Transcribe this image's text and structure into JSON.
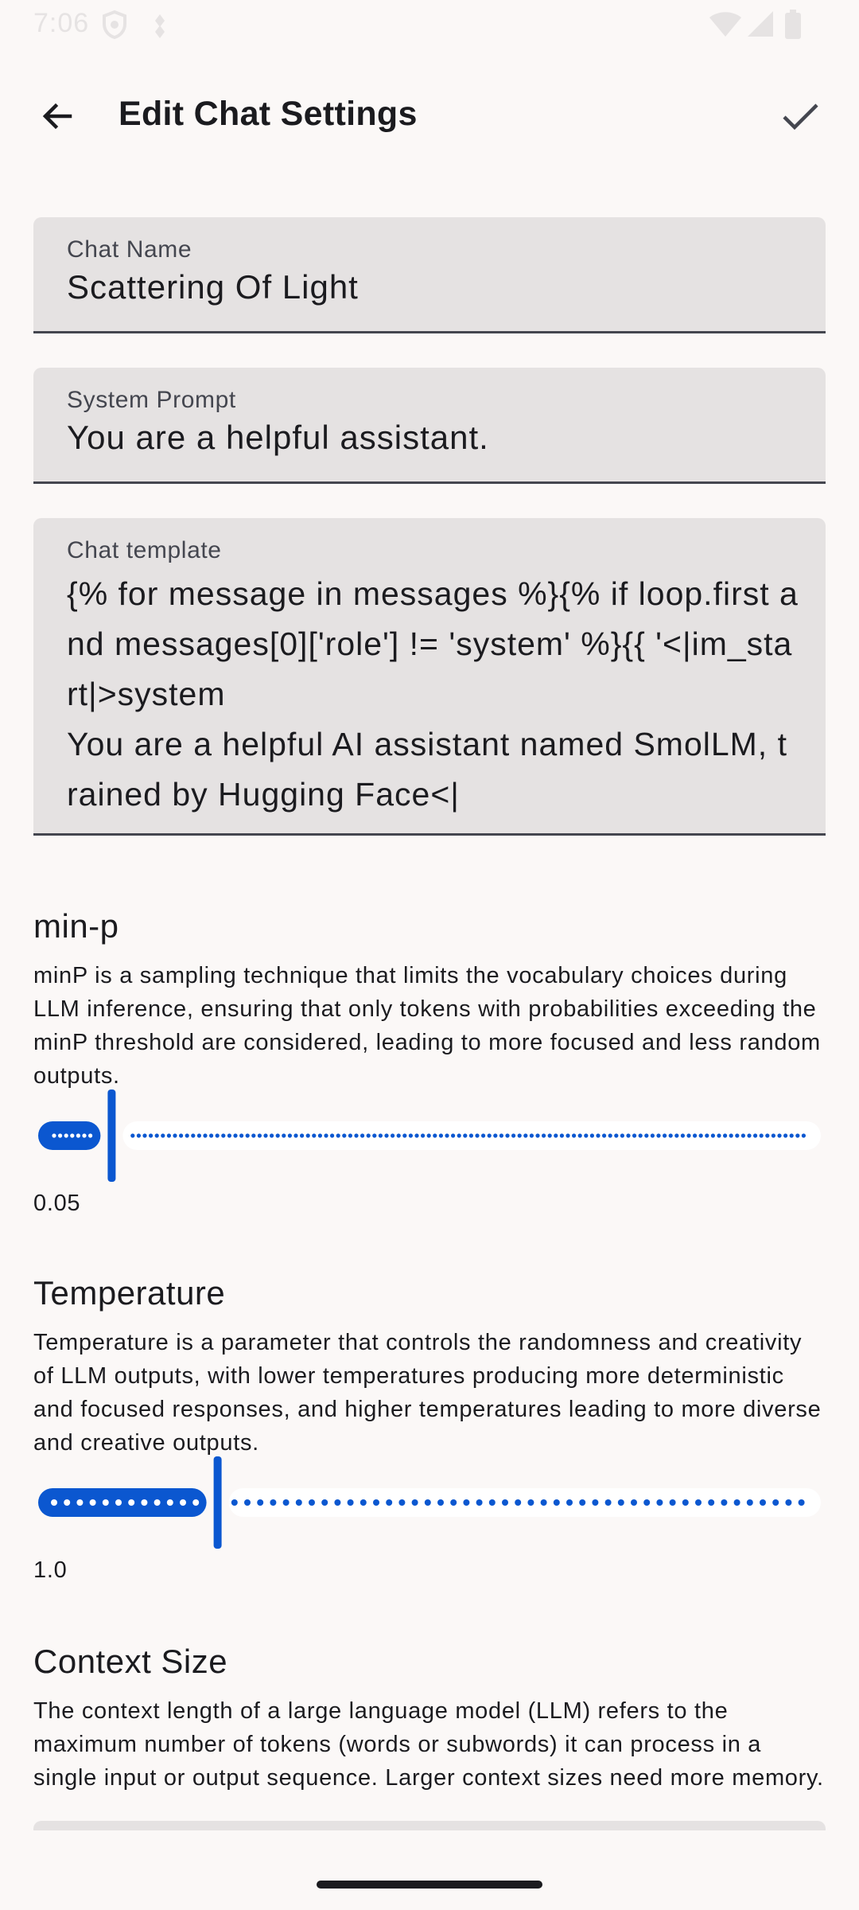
{
  "status_bar": {
    "time": "7:06",
    "icons": [
      "shield-icon",
      "dots-icon",
      "wifi-icon",
      "signal-icon",
      "battery-icon"
    ]
  },
  "app_bar": {
    "title": "Edit Chat Settings",
    "back_icon": "arrow-back-icon",
    "confirm_icon": "check-icon"
  },
  "fields": {
    "chat_name": {
      "label": "Chat Name",
      "value": "Scattering Of Light"
    },
    "system_prompt": {
      "label": "System Prompt",
      "value": "You are a helpful assistant."
    },
    "chat_template": {
      "label": "Chat template",
      "value": "{% for message in messages %}{% if loop.first and messages[0]['role'] != 'system' %}{{ '<|im_start|>system\nYou are a helpful AI assistant named SmolLM, trained by Hugging Face<|"
    }
  },
  "settings": {
    "min_p": {
      "title": "min-p",
      "description": "minP is a sampling technique that limits the vocabulary choices during LLM inference, ensuring that only tokens with probabilities exceeding the minP threshold are considered, leading to more focused and less random outputs.",
      "value_label": "0.05",
      "fraction": 0.05
    },
    "temperature": {
      "title": "Temperature",
      "description": "Temperature is a parameter that controls the randomness and creativity of LLM outputs, with lower temperatures producing more deterministic and focused responses, and higher temperatures leading to more diverse and creative outputs.",
      "value_label": "1.0",
      "fraction": 0.2
    },
    "context_size": {
      "title": "Context Size",
      "description": "The context length of a large language model (LLM) refers to the maximum number of tokens (words or subwords) it can process in a single input or output sequence. Larger context sizes need more memory."
    }
  },
  "colors": {
    "accent": "#0b57d0",
    "track_inactive": "#ffffff",
    "field_bg": "#e5e2e2",
    "background": "#fbf8f7"
  }
}
